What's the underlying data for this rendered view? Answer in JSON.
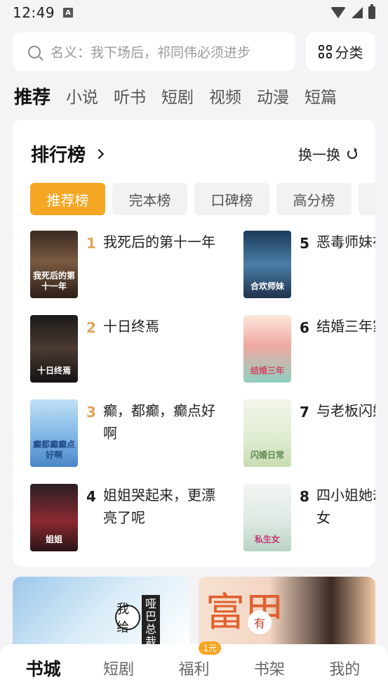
{
  "status_bar": {
    "time": "12:49",
    "notif_icon": "A"
  },
  "search": {
    "placeholder": "名义：我下场后，祁同伟必须进步",
    "category_label": "分类"
  },
  "top_tabs": [
    {
      "label": "推荐",
      "active": true
    },
    {
      "label": "小说"
    },
    {
      "label": "听书"
    },
    {
      "label": "短剧"
    },
    {
      "label": "视频"
    },
    {
      "label": "动漫"
    },
    {
      "label": "短篇"
    }
  ],
  "ranking": {
    "title": "排行榜",
    "refresh_label": "换一换",
    "chips": [
      "推荐榜",
      "完本榜",
      "口碑榜",
      "高分榜"
    ],
    "books": [
      {
        "rank": "1",
        "title": "我死后的第十一年",
        "cover_text": "我死后的第十一年"
      },
      {
        "rank": "2",
        "title": "十日终焉",
        "cover_text": "十日终焉"
      },
      {
        "rank": "3",
        "title": "癫，都癫，癫点好啊",
        "cover_text": "癫都癫癫点好啊"
      },
      {
        "rank": "4",
        "title": "姐姐哭起来，更漂亮了呢",
        "cover_text": "姐姐"
      },
      {
        "rank": "5",
        "title": "恶毒师妹在宗门",
        "cover_text": "合欢师妹"
      },
      {
        "rank": "6",
        "title": "结婚三年家，军婚",
        "cover_text": "结婚三年"
      },
      {
        "rank": "7",
        "title": "与老板闪婚日常",
        "cover_text": "闪婚日常"
      },
      {
        "rank": "8",
        "title": "四小姐她却是私生女",
        "cover_text": "私生女"
      }
    ]
  },
  "banners": {
    "banner_1": {
      "badge": "我给",
      "vertical": "哑巴总裁"
    },
    "banner_2": {
      "big_text": "富甲",
      "badge": "有"
    }
  },
  "bottom_nav": {
    "items": [
      "书城",
      "短剧",
      "福利",
      "书架",
      "我的"
    ],
    "welfare_badge": "1元"
  },
  "colors": {
    "accent": "#f5a623",
    "rank_top": "#e0a45a",
    "background": "#f4f4f6"
  }
}
